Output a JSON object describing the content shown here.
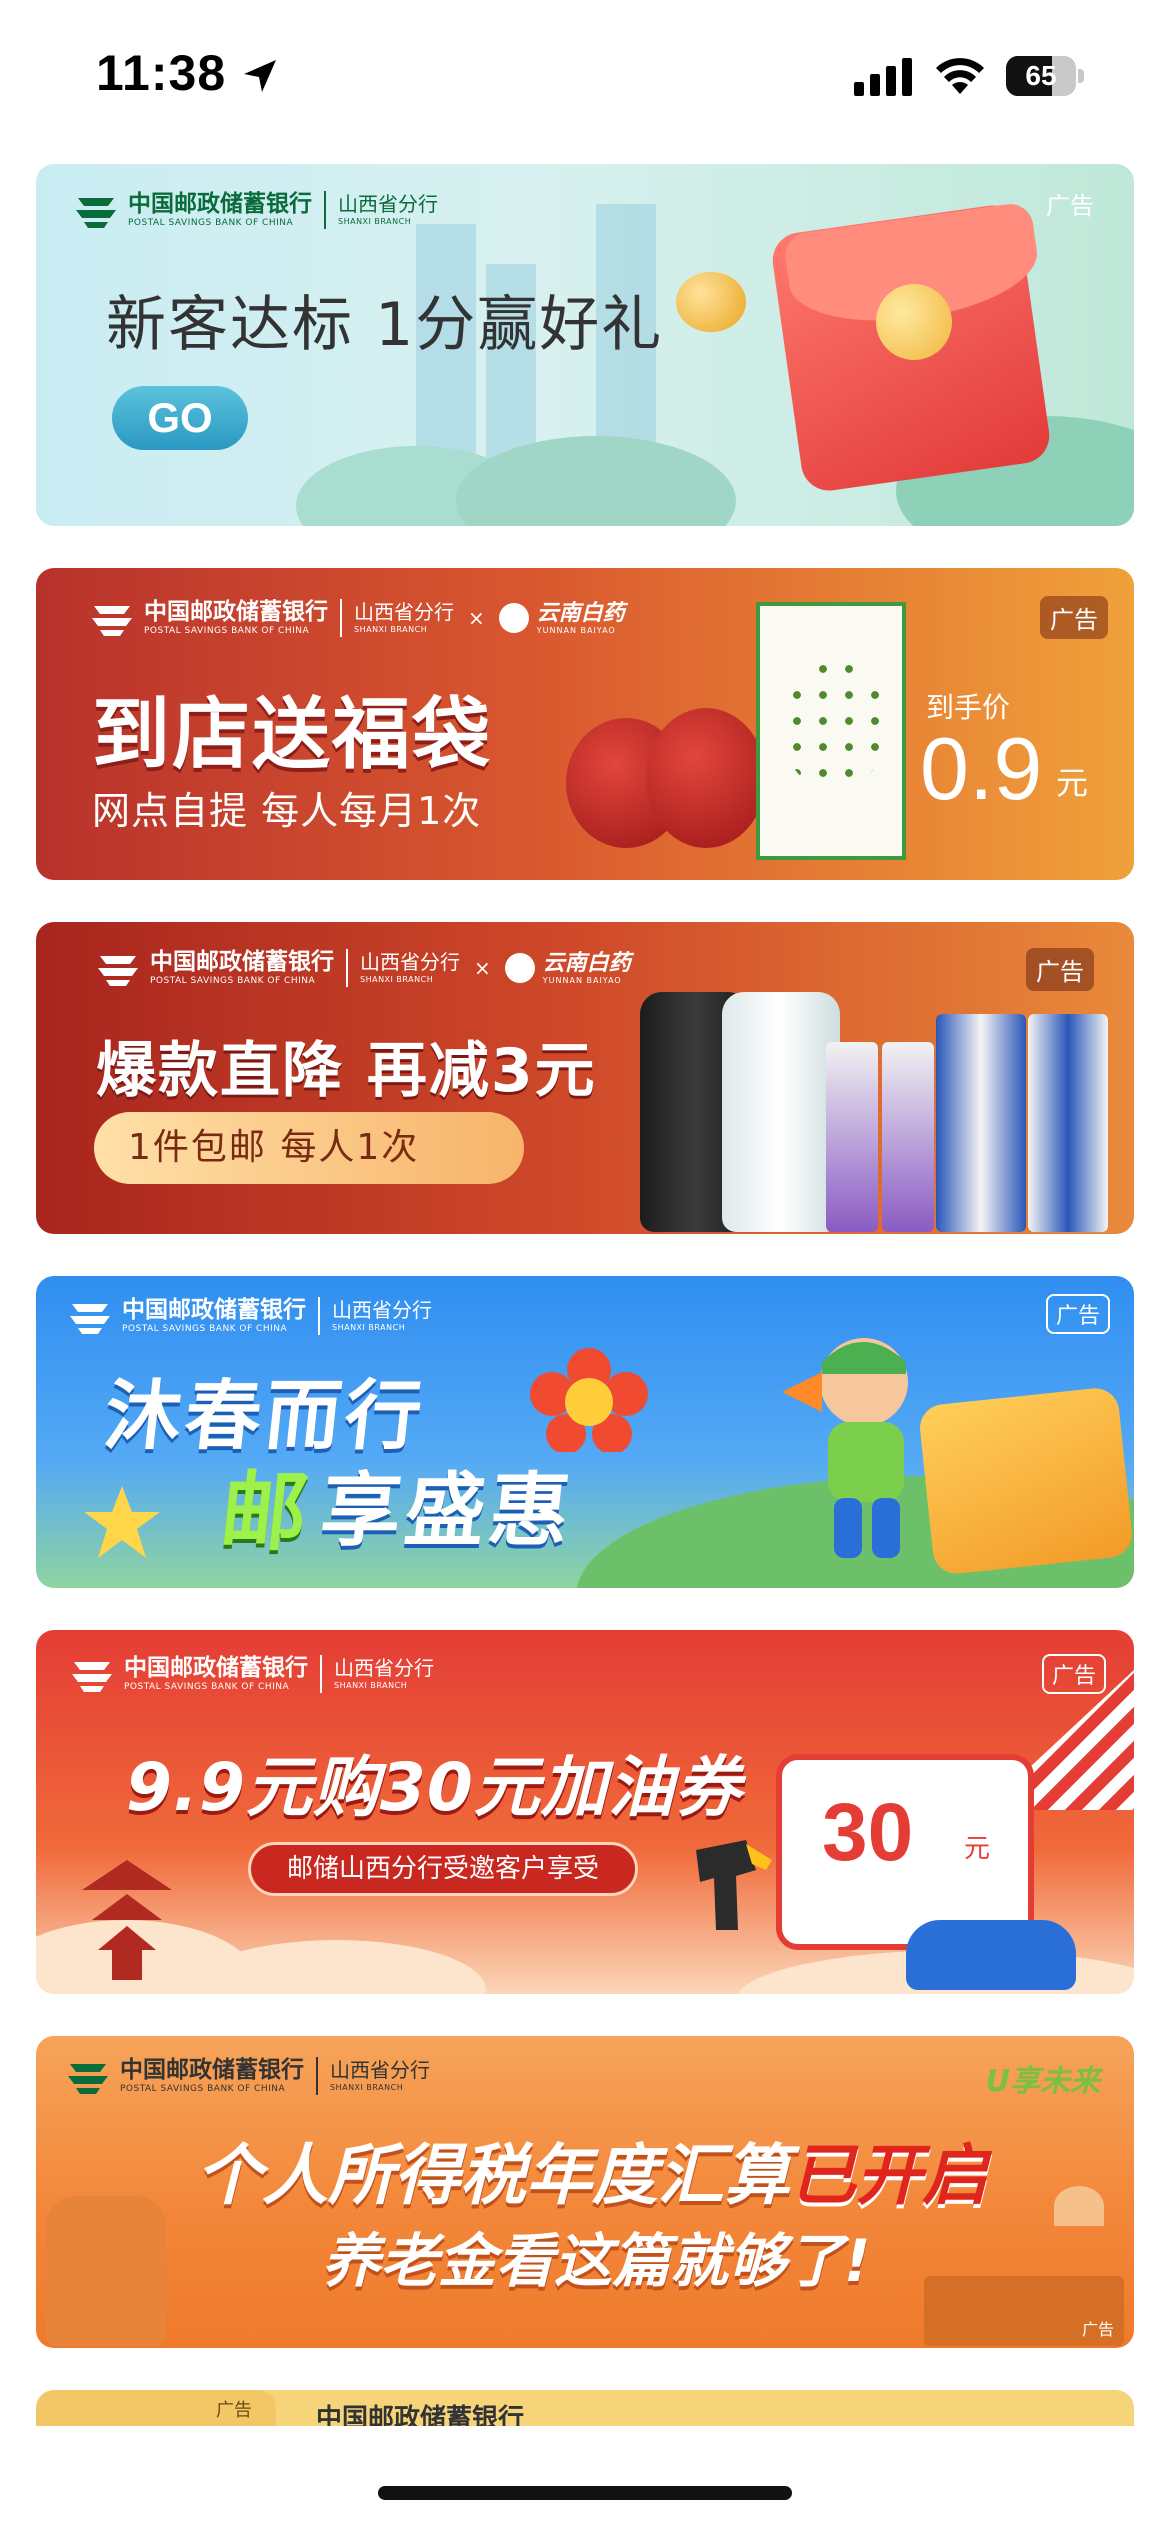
{
  "status_bar": {
    "time": "11:38",
    "battery": "65",
    "battery_level": 0.65
  },
  "bank": {
    "name_cn": "中国邮政储蓄银行",
    "name_en": "POSTAL SAVINGS BANK OF CHINA",
    "branch_cn": "山西省分行",
    "branch_en": "SHANXI BRANCH"
  },
  "partner": {
    "name_cn": "云南白药",
    "name_en": "YUNNAN BAIYAO",
    "separator": "×"
  },
  "banners": {
    "b1": {
      "ad": "广告",
      "headline": "新客达标 1分赢好礼",
      "cta": "GO"
    },
    "b2": {
      "ad": "广告",
      "title": "到店送福袋",
      "subtitle": "网点自提 每人每月1次",
      "price_label": "到手价",
      "price": "0.9",
      "price_unit": "元"
    },
    "b3": {
      "ad": "广告",
      "title": "爆款直降 再减3元",
      "pill": "1件包邮 每人1次"
    },
    "b4": {
      "ad": "广告",
      "line1": "沐春而行",
      "line2_highlight": "邮",
      "line2_rest": "享盛惠"
    },
    "b5": {
      "ad": "广告",
      "title": "9.9元购30元加油券",
      "pill": "邮储山西分行受邀客户享受",
      "card_value": "30",
      "card_unit": "元"
    },
    "b6": {
      "ad": "广告",
      "brand": "U享未来",
      "line1_main": "个人所得税年度汇算",
      "line1_highlight": "已开启",
      "line2": "养老金看这篇就够了!"
    },
    "b7": {
      "ad": "广告"
    }
  },
  "colors": {
    "psbc_green": "#0a6b3b",
    "accent_red": "#e43d35",
    "accent_orange": "#f3873a",
    "accent_blue": "#2f8ef0"
  }
}
